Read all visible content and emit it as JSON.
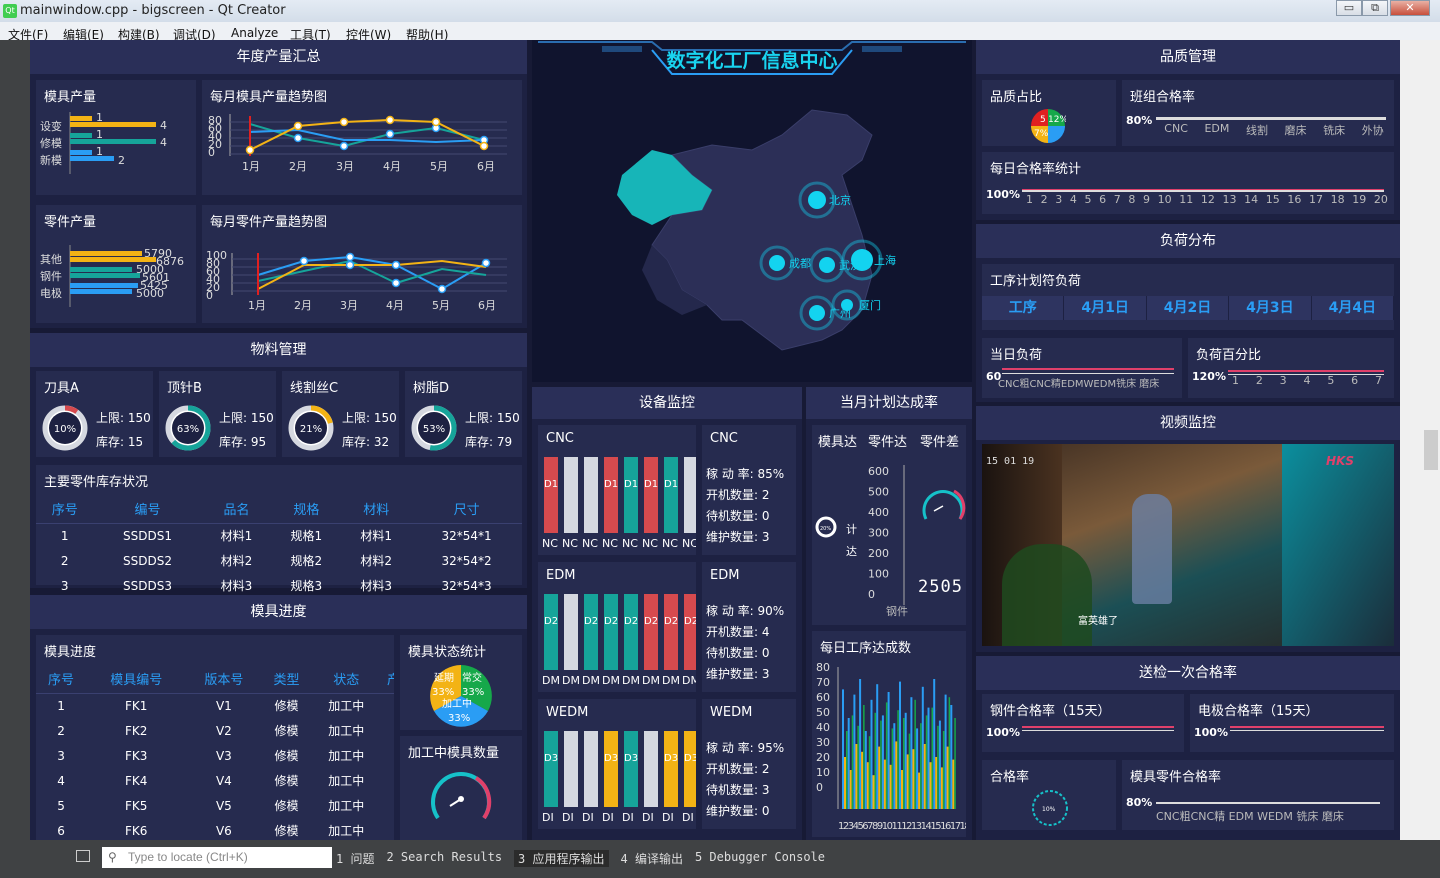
{
  "window": {
    "title": "mainwindow.cpp - bigscreen - Qt Creator",
    "min": "▭",
    "max": "⧉",
    "close": "✕"
  },
  "menu": [
    "文件(F)",
    "编辑(E)",
    "构建(B)",
    "调试(D)",
    "Analyze",
    "工具(T)",
    "控件(W)",
    "帮助(H)"
  ],
  "header": {
    "center_title": "数字化工厂信息中心"
  },
  "annual": {
    "title": "年度产量汇总",
    "mold": {
      "label": "模具产量",
      "cats": [
        "设变",
        "修模",
        "新模"
      ],
      "bars": [
        [
          "1",
          "4"
        ],
        [
          "1",
          "4"
        ],
        [
          "1",
          "2"
        ]
      ]
    },
    "mold_trend": {
      "label": "每月模具产量趋势图",
      "yticks": [
        "80",
        "60",
        "40",
        "20",
        "0"
      ],
      "months": [
        "1月",
        "2月",
        "3月",
        "4月",
        "5月",
        "6月"
      ]
    },
    "part": {
      "label": "零件产量",
      "cats": [
        "其他",
        "钢件",
        "电极"
      ],
      "vals": [
        "5790",
        "6876",
        "5000",
        "5601",
        "5425",
        "5000"
      ]
    },
    "part_trend": {
      "label": "每月零件产量趋势图",
      "yticks": [
        "100",
        "80",
        "60",
        "40",
        "20",
        "0"
      ],
      "months": [
        "1月",
        "2月",
        "3月",
        "4月",
        "5月",
        "6月"
      ]
    }
  },
  "material": {
    "title": "物料管理",
    "items": [
      {
        "name": "刀具A",
        "pct": "10%",
        "limit": "上限: 150",
        "stock": "库存: 15",
        "p": 0.1,
        "color": "#d64a4e"
      },
      {
        "name": "顶针B",
        "pct": "63%",
        "limit": "上限: 150",
        "stock": "库存: 95",
        "p": 0.63,
        "color": "#16a49a"
      },
      {
        "name": "线割丝C",
        "pct": "21%",
        "limit": "上限: 150",
        "stock": "库存: 32",
        "p": 0.21,
        "color": "#f3b315"
      },
      {
        "name": "树脂D",
        "pct": "53%",
        "limit": "上限: 150",
        "stock": "库存: 79",
        "p": 0.53,
        "color": "#16a49a"
      }
    ],
    "stock_title": "主要零件库存状况",
    "cols": [
      "序号",
      "编号",
      "品名",
      "规格",
      "材料",
      "尺寸"
    ],
    "rows": [
      [
        "1",
        "SSDDS1",
        "材料1",
        "规格1",
        "材料1",
        "32*54*1"
      ],
      [
        "2",
        "SSDDS2",
        "材料2",
        "规格2",
        "材料2",
        "32*54*2"
      ],
      [
        "3",
        "SSDDS3",
        "材料3",
        "规格3",
        "材料3",
        "32*54*3"
      ]
    ]
  },
  "mold_progress": {
    "title": "模具进度",
    "sub": "模具进度",
    "cols": [
      "序号",
      "模具编号",
      "版本号",
      "类型",
      "状态",
      "产"
    ],
    "rows": [
      [
        "1",
        "FK1",
        "V1",
        "修模",
        "加工中"
      ],
      [
        "2",
        "FK2",
        "V2",
        "修模",
        "加工中"
      ],
      [
        "3",
        "FK3",
        "V3",
        "修模",
        "加工中"
      ],
      [
        "4",
        "FK4",
        "V4",
        "修模",
        "加工中"
      ],
      [
        "5",
        "FK5",
        "V5",
        "修模",
        "加工中"
      ],
      [
        "6",
        "FK6",
        "V6",
        "修模",
        "加工中"
      ]
    ],
    "status_title": "模具状态统计",
    "pie": [
      "延期",
      "常交",
      "加工中",
      "33%",
      "33%",
      "33%"
    ],
    "processing_title": "加工中模具数量"
  },
  "map": {
    "cities": [
      "北京",
      "上海",
      "武汉",
      "成都",
      "厦门",
      "广州"
    ]
  },
  "equipment": {
    "title": "设备监控",
    "groups": [
      {
        "name": "CNC",
        "bar_label": "NC",
        "rate": "稼 动 率: 85%",
        "on": "开机数量: 2",
        "wait": "待机数量: 0",
        "maint": "维护数量: 3",
        "code": "D1"
      },
      {
        "name": "EDM",
        "bar_label": "DM",
        "rate": "稼 动 率: 90%",
        "on": "开机数量: 4",
        "wait": "待机数量: 0",
        "maint": "维护数量: 3",
        "code": "D2"
      },
      {
        "name": "WEDM",
        "bar_label": "DI",
        "rate": "稼 动 率: 95%",
        "on": "开机数量: 2",
        "wait": "待机数量: 3",
        "maint": "维护数量: 0",
        "code": "D3"
      }
    ]
  },
  "plan": {
    "title": "当月计划达成率",
    "tabs": [
      "模具达",
      "零件达",
      "零件差"
    ],
    "yticks": [
      "600",
      "500",
      "400",
      "300",
      "200",
      "100",
      "0"
    ],
    "counter": "2505",
    "mini": "20%",
    "vt": [
      "计",
      "达"
    ],
    "bottom": "钢件",
    "daily_title": "每日工序达成数",
    "daily_y": [
      "80",
      "70",
      "60",
      "50",
      "40",
      "30",
      "20",
      "10",
      "0"
    ],
    "daily_x": "1234567891011121314151617181920"
  },
  "quality": {
    "title": "品质管理",
    "ratio": "品质占比",
    "team": "班组合格率",
    "team_pct": "80%",
    "team_cats": [
      "CNC",
      "EDM",
      "线割",
      "磨床",
      "铣床",
      "外协"
    ],
    "pie_vals": [
      "5",
      "12%",
      "7%",
      "1%"
    ],
    "daily": "每日合格率统计",
    "daily_pct": "100%",
    "days": [
      "1",
      "2",
      "3",
      "4",
      "5",
      "6",
      "7",
      "8",
      "9",
      "10",
      "11",
      "12",
      "13",
      "14",
      "15",
      "16",
      "17",
      "18",
      "19",
      "20"
    ]
  },
  "load": {
    "title": "负荷分布",
    "plan": "工序计划符负荷",
    "cols": [
      "工序",
      "4月1日",
      "4月2日",
      "4月3日",
      "4月4日"
    ],
    "today": "当日负荷",
    "today_pct": "60",
    "today_cats": "CNC粗CNC精EDMWEDM铣床 磨床",
    "pct_title": "负荷百分比",
    "pct_val": "120%",
    "pct_x": [
      "1",
      "2",
      "3",
      "4",
      "5",
      "6",
      "7"
    ]
  },
  "video": {
    "title": "视频监控",
    "brand": "HKS",
    "ts": "15 01 19",
    "caption": "富英雄了"
  },
  "inspection": {
    "title": "送检一次合格率",
    "steel": "钢件合格率（15天）",
    "elec": "电极合格率（15天）",
    "pct": "100%",
    "pass": "合格率",
    "gauge": "10%",
    "mold_part": "模具零件合格率",
    "mp_pct": "80%",
    "mp_cats": "CNC粗CNC精 EDM WEDM 铣床  磨床"
  },
  "status": {
    "locator": "Type to locate (Ctrl+K)",
    "tabs": [
      "1 问题",
      "2 Search Results",
      "3 应用程序输出",
      "4 编译输出",
      "5 Debugger Console"
    ]
  }
}
